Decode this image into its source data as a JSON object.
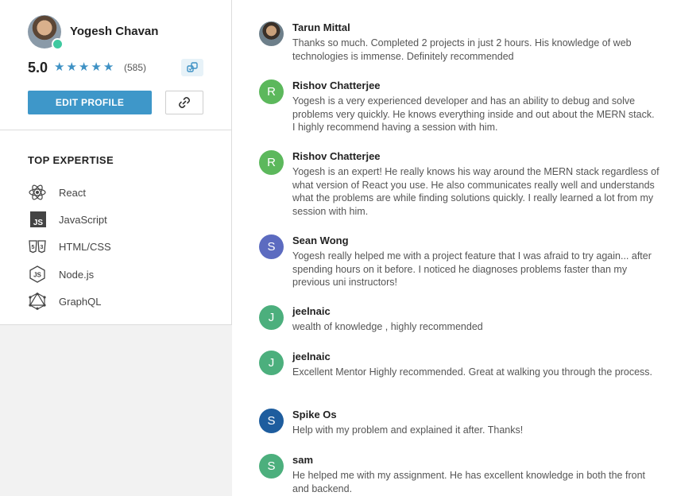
{
  "profile": {
    "name": "Yogesh Chavan",
    "rating": "5.0",
    "stars": 5,
    "review_count": "(585)",
    "edit_label": "EDIT PROFILE"
  },
  "expertise": {
    "title": "TOP EXPERTISE",
    "items": [
      {
        "label": "React",
        "icon": "react-icon"
      },
      {
        "label": "JavaScript",
        "icon": "javascript-icon"
      },
      {
        "label": "HTML/CSS",
        "icon": "html-css-icon"
      },
      {
        "label": "Node.js",
        "icon": "nodejs-icon"
      },
      {
        "label": "GraphQL",
        "icon": "graphql-icon"
      }
    ]
  },
  "reviews": [
    {
      "name": "Tarun Mittal",
      "initial": "",
      "color": "",
      "text": "Thanks so much. Completed 2 projects in just 2 hours. His knowledge of web technologies is immense. Definitely recommended"
    },
    {
      "name": "Rishov Chatterjee",
      "initial": "R",
      "color": "#5cb85c",
      "text": "Yogesh is a very experienced developer and has an ability to debug and solve problems very quickly. He knows everything inside and out about the MERN stack. I highly recommend having a session with him."
    },
    {
      "name": "Rishov Chatterjee",
      "initial": "R",
      "color": "#5cb85c",
      "text": "Yogesh is an expert! He really knows his way around the MERN stack regardless of what version of React you use. He also communicates really well and understands what the problems are while finding solutions quickly. I really learned a lot from my session with him."
    },
    {
      "name": "Sean Wong",
      "initial": "S",
      "color": "#5c6bc0",
      "text": "Yogesh really helped me with a project feature that I was afraid to try again... after spending hours on it before. I noticed he diagnoses problems faster than my previous uni instructors!"
    },
    {
      "name": "jeelnaic",
      "initial": "J",
      "color": "#4caf7d",
      "text": "wealth of knowledge , highly recommended"
    },
    {
      "name": "jeelnaic",
      "initial": "J",
      "color": "#4caf7d",
      "text": "Excellent Mentor Highly recommended. Great at walking you through the process."
    },
    {
      "name": "Spike Os",
      "initial": "S",
      "color": "#1e5d9e",
      "text": "Help with my problem and explained it after. Thanks!"
    },
    {
      "name": "sam",
      "initial": "S",
      "color": "#4caf7d",
      "text": "He helped me with my assignment. He has excellent knowledge in both the front and backend."
    }
  ]
}
